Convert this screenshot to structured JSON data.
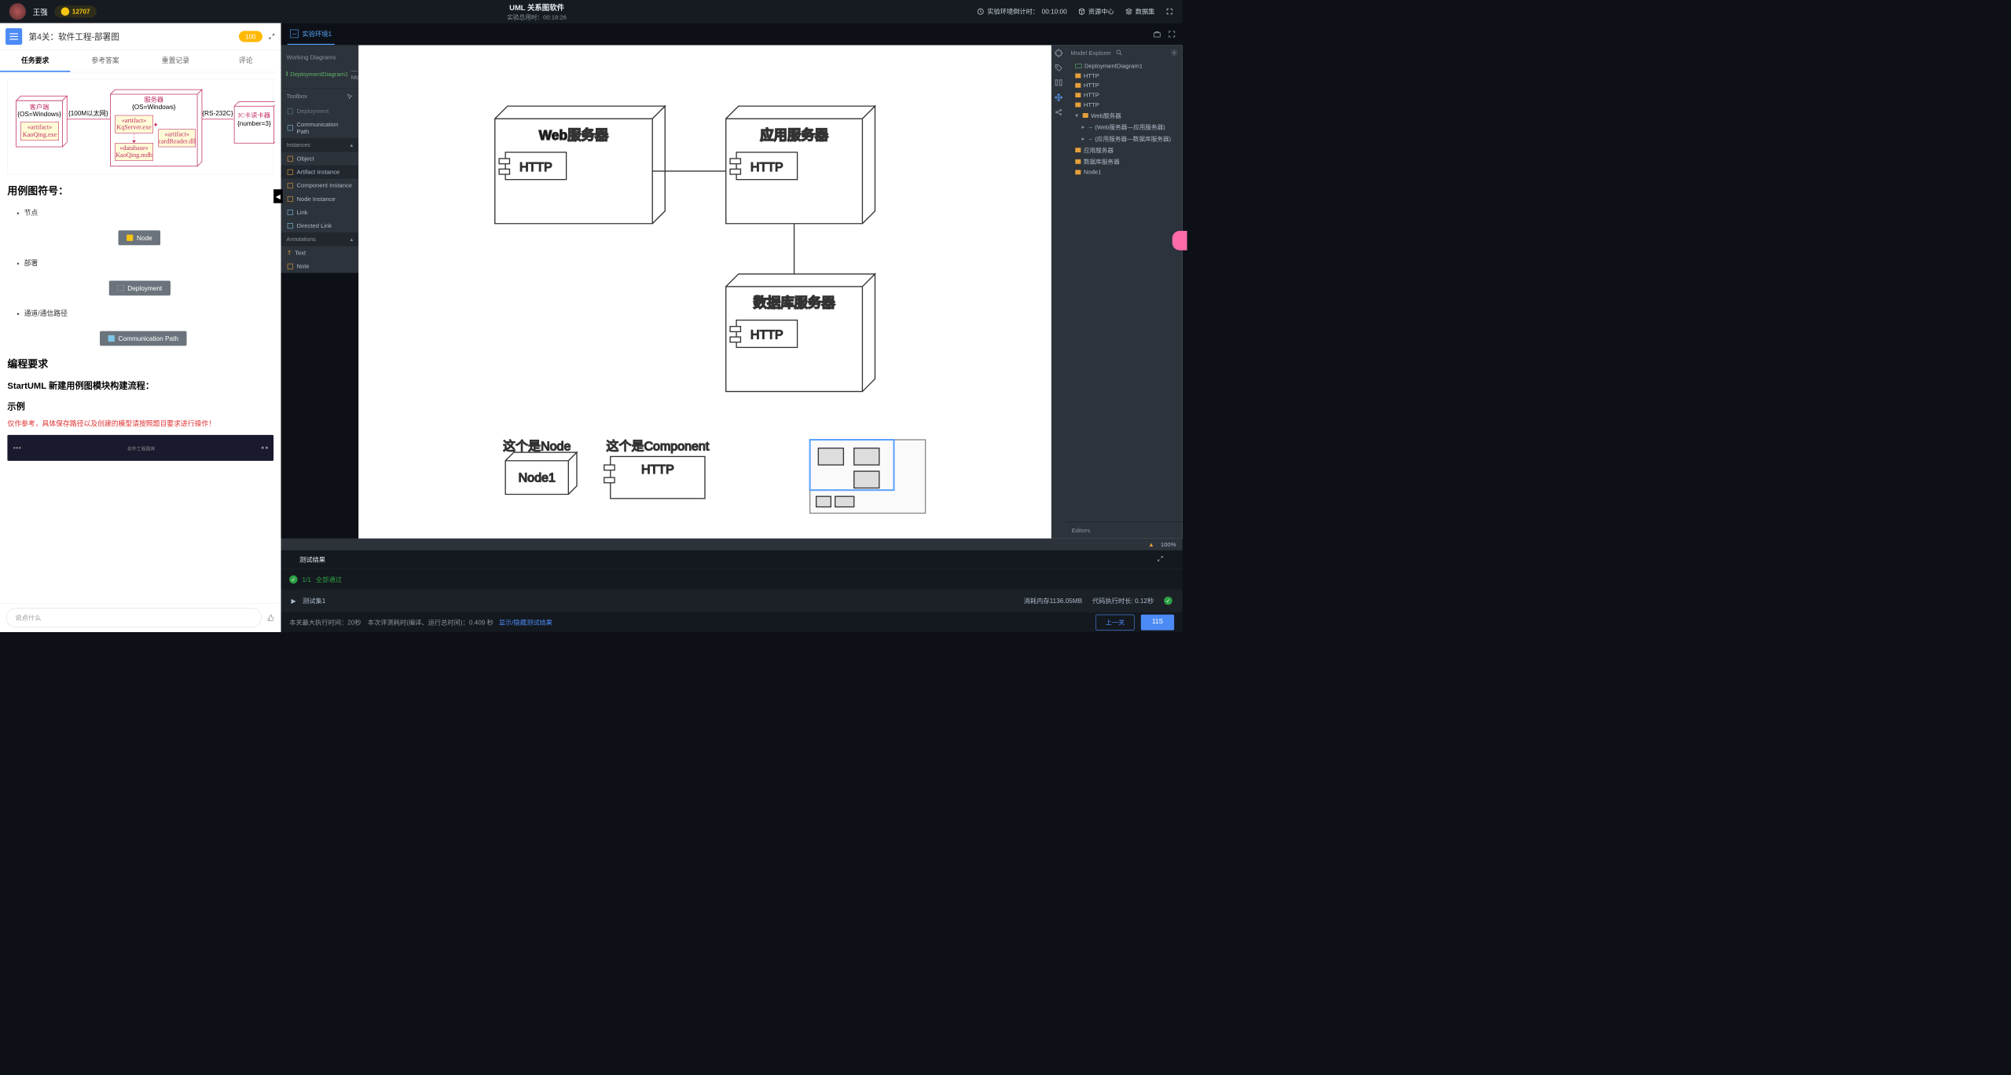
{
  "header": {
    "username": "王强",
    "coins": "12707",
    "app_title": "UML 关系图软件",
    "total_time_label": "实验总用时：",
    "total_time": "00:18:26",
    "countdown_label": "实验环境倒计时：",
    "countdown_time": "00:10:00",
    "resource_center": "资源中心",
    "dataset": "数据集"
  },
  "left": {
    "title": "第4关：软件工程-部署图",
    "badge": "100",
    "tabs": {
      "req": "任务要求",
      "ans": "参考答案",
      "reset": "重置记录",
      "comment": "评论"
    },
    "diagram": {
      "client": "客户端",
      "client_os": "{OS=Windows}",
      "art": "«artifact»",
      "kaoqing": "KaoQing.exe",
      "eth": "{100M以太网}",
      "server": "服务器",
      "server_os": "{OS=Windows}",
      "kqserver": "KqServer.exe",
      "db": "«database»",
      "kaoqingmdb": "KaoQing.mdb",
      "cardreader": "cardReader.dll",
      "rs232": "{RS-232C}",
      "icreader": "IC卡读卡器",
      "number3": "{number=3}"
    },
    "sec_symbols": "用例图符号：",
    "li_node": "节点",
    "li_deploy": "部署",
    "li_path": "通道/通信路径",
    "btn_node": "Node",
    "btn_deploy": "Deployment",
    "btn_comm": "Communication Path",
    "sec_req": "编程要求",
    "sec_flow": "StartUML 新建用例图模块构建流程：",
    "sec_example": "示例",
    "warn": "仅作参考，具体保存路径以及创建的模型请按照题目要求进行操作！",
    "input_placeholder": "说点什么"
  },
  "right": {
    "env_tab": "实验环境1",
    "working_diagrams": "Working Diagrams",
    "diag_name": "DeploymentDiagram1",
    "diag_suffix": "— Mod",
    "toolbox": "Toolbox",
    "tb_deploy": "Deployment",
    "tb_comm": "Communication Path",
    "tb_instances": "Instances",
    "tb_object": "Object",
    "tb_artifact": "Artifact Instance",
    "tb_compinst": "Component Instance",
    "tb_nodeinst": "Node Instance",
    "tb_link": "Link",
    "tb_dlink": "Directed Link",
    "tb_annot": "Annotations",
    "tb_text": "Text",
    "tb_note": "Note",
    "explorer": {
      "title": "Model Explorer",
      "items": {
        "root": "DeploymentDiagram1",
        "http1": "HTTP",
        "http2": "HTTP",
        "http3": "HTTP",
        "http4": "HTTP",
        "web": "Web服务器",
        "rel1": "(Web服务器—应用服务器)",
        "rel2": "(应用服务器—数据库服务器)",
        "app": "应用服务器",
        "db": "数据库服务器",
        "node1": "Node1"
      },
      "editors": "Editors"
    },
    "zoom": "100%",
    "canvas": {
      "web": "Web服务器",
      "app": "应用服务器",
      "db": "数据库服务器",
      "http": "HTTP",
      "note_node": "这个是Node",
      "note_comp": "这个是Component",
      "node1": "Node1"
    },
    "test": {
      "title": "测试结果",
      "count": "1/1",
      "pass": "全部通过",
      "set1": "测试集1",
      "mem": "消耗内存1136.05MB",
      "time_label": "代码执行时长:",
      "time": "0.12秒"
    },
    "bottom": {
      "stats": "本关最大执行时间：20秒 本次评测耗时(编译、运行总时间)：0.409 秒",
      "toggle": "显示/隐藏测试结果",
      "prev": "上一关",
      "next": "11S"
    }
  }
}
